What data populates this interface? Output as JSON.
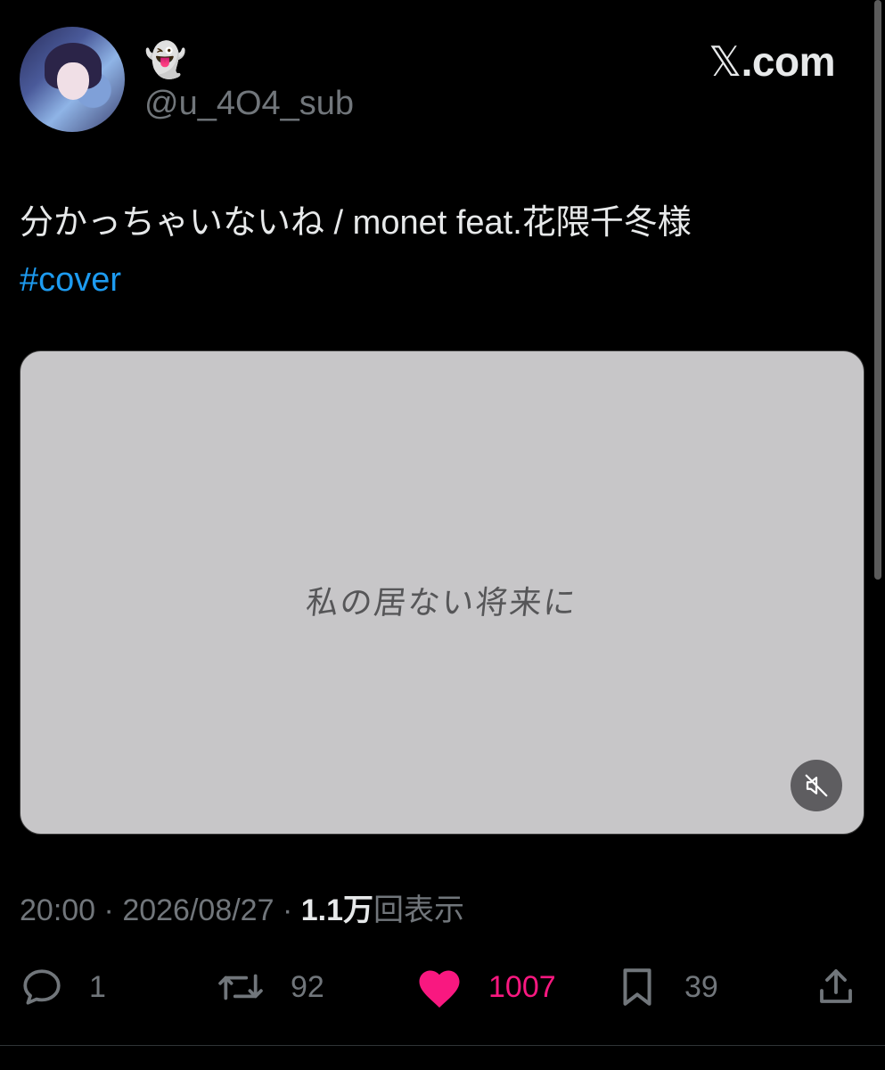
{
  "header": {
    "display_name": "👻",
    "handle": "@u_4O4_sub",
    "site_logo": "𝕏",
    "site_text": ".com"
  },
  "tweet": {
    "text": "分かっちゃいないね / monet feat.花隈千冬様",
    "hashtag": "#cover",
    "media_caption": "私の居ない将来に",
    "mute_icon": "speaker-muted-icon"
  },
  "meta": {
    "time": "20:00",
    "date": "2026/08/27",
    "separator": "·",
    "views_count": "1.1万",
    "views_label": "回表示"
  },
  "actions": {
    "reply_count": "1",
    "retweet_count": "92",
    "like_count": "1007",
    "bookmark_count": "39"
  },
  "colors": {
    "background": "#000000",
    "hashtag": "#1d9bf0",
    "like": "#f91880",
    "muted_text": "#71767b"
  }
}
